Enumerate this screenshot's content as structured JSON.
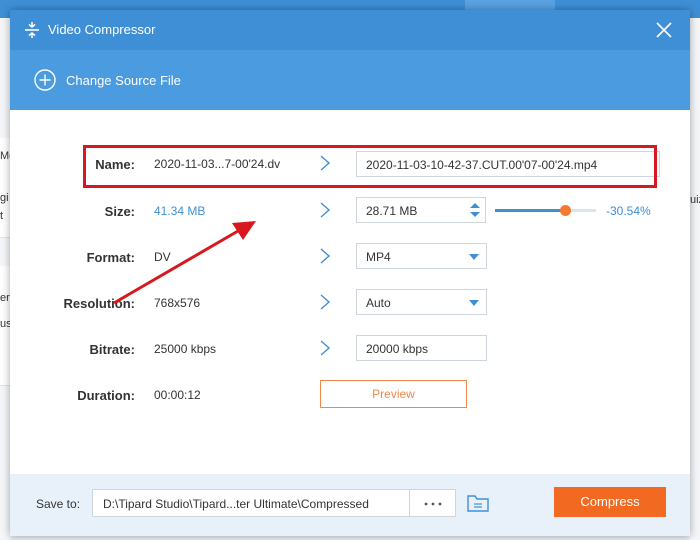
{
  "dialog": {
    "title": "Video Compressor",
    "icons": {
      "title": "compress-icon",
      "close": "close-icon"
    }
  },
  "source": {
    "label": "Change Source File",
    "icon": "plus-circle-icon"
  },
  "form": {
    "name": {
      "label": "Name:",
      "source_value": "2020-11-03...7-00'24.dv",
      "output_value": "2020-11-03-10-42-37.CUT.00'07-00'24.mp4"
    },
    "size": {
      "label": "Size:",
      "source_value": "41.34 MB",
      "output_value": "28.71 MB",
      "percent": "-30.54%",
      "slider_level": 0.6946
    },
    "format": {
      "label": "Format:",
      "source_value": "DV",
      "output_value": "MP4"
    },
    "resolution": {
      "label": "Resolution:",
      "source_value": "768x576",
      "output_value": "Auto"
    },
    "bitrate": {
      "label": "Bitrate:",
      "source_value": "25000 kbps",
      "output_value": "20000 kbps"
    },
    "duration": {
      "label": "Duration:",
      "source_value": "00:00:12",
      "preview_label": "Preview"
    }
  },
  "footer": {
    "save_to_label": "Save to:",
    "path": "D:\\Tipard Studio\\Tipard...ter Ultimate\\Compressed",
    "browse_label": "···",
    "compress_label": "Compress"
  },
  "background": {
    "fragments": [
      "Me",
      "gi",
      "t",
      "er",
      "us",
      "uiz"
    ]
  },
  "colors": {
    "accent": "#3f8fd6",
    "header": "#4a9be0",
    "orange": "#f26a22",
    "annotation": "#d7191f"
  }
}
